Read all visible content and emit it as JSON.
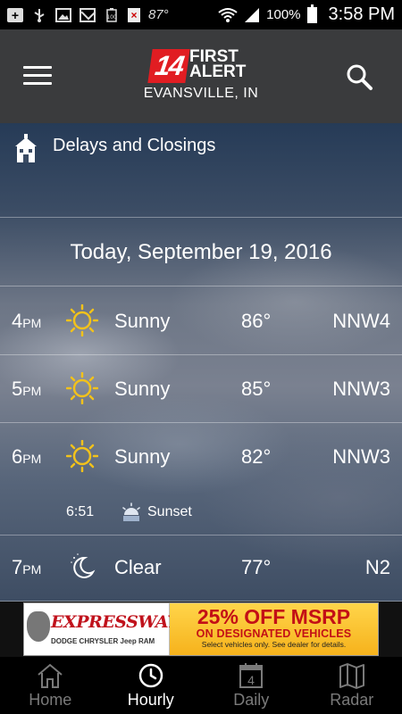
{
  "status_bar": {
    "temperature": "87°",
    "battery_percent": "100%",
    "time": "3:58 PM",
    "card_icon_text": "×",
    "icons": [
      "plus-box-icon",
      "usb-icon",
      "image-icon",
      "gmail-icon",
      "battery-100-icon",
      "card-icon",
      "wifi-icon",
      "signal-icon",
      "battery-icon"
    ]
  },
  "header": {
    "logo_number": "14",
    "logo_line1": "FIRST",
    "logo_line2": "ALERT",
    "location": "EVANSVILLE, IN"
  },
  "delays": {
    "label": "Delays and Closings",
    "icon": "schoolhouse-icon"
  },
  "date_header": "Today, September 19, 2016",
  "hours": [
    {
      "hour": "4",
      "ampm": "PM",
      "condition": "Sunny",
      "temp": "86°",
      "wind": "NNW4",
      "icon": "sun-icon"
    },
    {
      "hour": "5",
      "ampm": "PM",
      "condition": "Sunny",
      "temp": "85°",
      "wind": "NNW3",
      "icon": "sun-icon"
    },
    {
      "hour": "6",
      "ampm": "PM",
      "condition": "Sunny",
      "temp": "82°",
      "wind": "NNW3",
      "icon": "sun-icon"
    },
    {
      "hour": "7",
      "ampm": "PM",
      "condition": "Clear",
      "temp": "77°",
      "wind": "N2",
      "icon": "moon-icon"
    }
  ],
  "sunset": {
    "time": "6:51",
    "label": "Sunset",
    "icon": "sunset-icon"
  },
  "ad": {
    "brand": "EXPRESSWAY",
    "brand_sub": "DODGE CHRYSLER Jeep RAM",
    "headline": "25% OFF MSRP",
    "subline": "ON DESIGNATED VEHICLES",
    "fineprint": "Select vehicles only. See dealer for details."
  },
  "nav": {
    "active": "Hourly",
    "items": [
      {
        "label": "Home",
        "icon": "home-icon"
      },
      {
        "label": "Hourly",
        "icon": "clock-icon"
      },
      {
        "label": "Daily",
        "icon": "calendar-icon",
        "badge": "4"
      },
      {
        "label": "Radar",
        "icon": "map-icon"
      }
    ]
  },
  "colors": {
    "header_bg": "#3a3b3d",
    "logo_red": "#e11d22",
    "sun_yellow": "#f2c21b",
    "nav_active": "#ffffff",
    "nav_inactive": "#7a7a7a"
  }
}
